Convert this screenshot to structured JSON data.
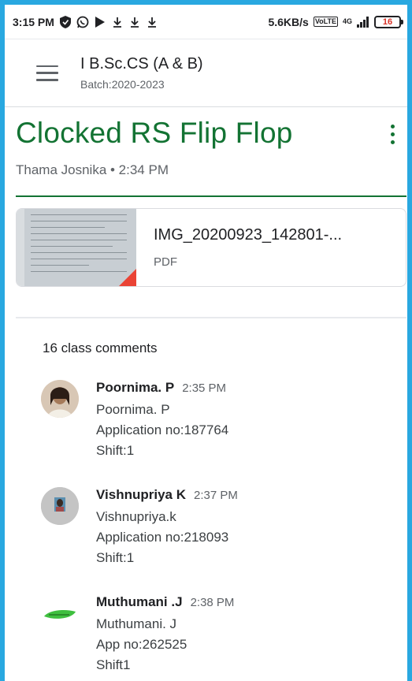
{
  "status_bar": {
    "time": "3:15 PM",
    "speed": "5.6KB/s",
    "lte": "VoLTE",
    "network": "4G",
    "battery": "16"
  },
  "app_bar": {
    "class_name": "I B.Sc.CS (A & B)",
    "batch": "Batch:2020-2023"
  },
  "post": {
    "title": "Clocked RS Flip Flop",
    "meta": "Thama Josnika • 2:34 PM"
  },
  "attachment": {
    "name": "IMG_20200923_142801-...",
    "type": "PDF"
  },
  "comments": {
    "header": "16 class comments",
    "items": [
      {
        "name": "Poornima. P",
        "time": "2:35 PM",
        "lines": [
          "Poornima. P",
          "Application no:187764",
          "Shift:1"
        ]
      },
      {
        "name": "Vishnupriya K",
        "time": "2:37 PM",
        "lines": [
          "Vishnupriya.k",
          "Application no:218093",
          "Shift:1"
        ]
      },
      {
        "name": "Muthumani .J",
        "time": "2:38 PM",
        "lines": [
          "Muthumani. J",
          "App no:262525",
          "Shift1"
        ]
      }
    ]
  },
  "colors": {
    "accent_green": "#137333",
    "frame_border": "#29a8e0",
    "pdf_badge": "#ea4335"
  },
  "icons": [
    "menu-icon",
    "more-vert-icon",
    "pdf-icon",
    "shield-icon",
    "whatsapp-icon",
    "play-store-icon",
    "download-icon",
    "signal-icon",
    "battery-icon"
  ]
}
